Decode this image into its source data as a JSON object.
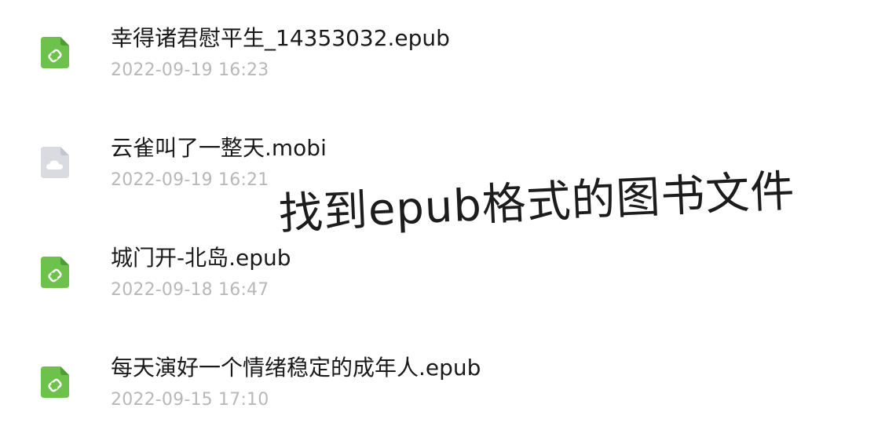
{
  "files": [
    {
      "name": "幸得诸君慰平生_14353032.epub",
      "date": "2022-09-19 16:23",
      "type": "epub",
      "icon": "epub-file-icon",
      "icon_color": "#6cc24a"
    },
    {
      "name": "云雀叫了一整天.mobi",
      "date": "2022-09-19 16:21",
      "type": "mobi",
      "icon": "cloud-file-icon",
      "icon_color": "#d9dbe0"
    },
    {
      "name": "城门开-北岛.epub",
      "date": "2022-09-18 16:47",
      "type": "epub",
      "icon": "epub-file-icon",
      "icon_color": "#6cc24a"
    },
    {
      "name": "每天演好一个情绪稳定的成年人.epub",
      "date": "2022-09-15 17:10",
      "type": "epub",
      "icon": "epub-file-icon",
      "icon_color": "#6cc24a"
    }
  ],
  "overlay": {
    "caption": "找到epub格式的图书文件"
  },
  "colors": {
    "name_text": "#1a1a1a",
    "date_text": "#b8b8b8",
    "background": "#ffffff"
  }
}
